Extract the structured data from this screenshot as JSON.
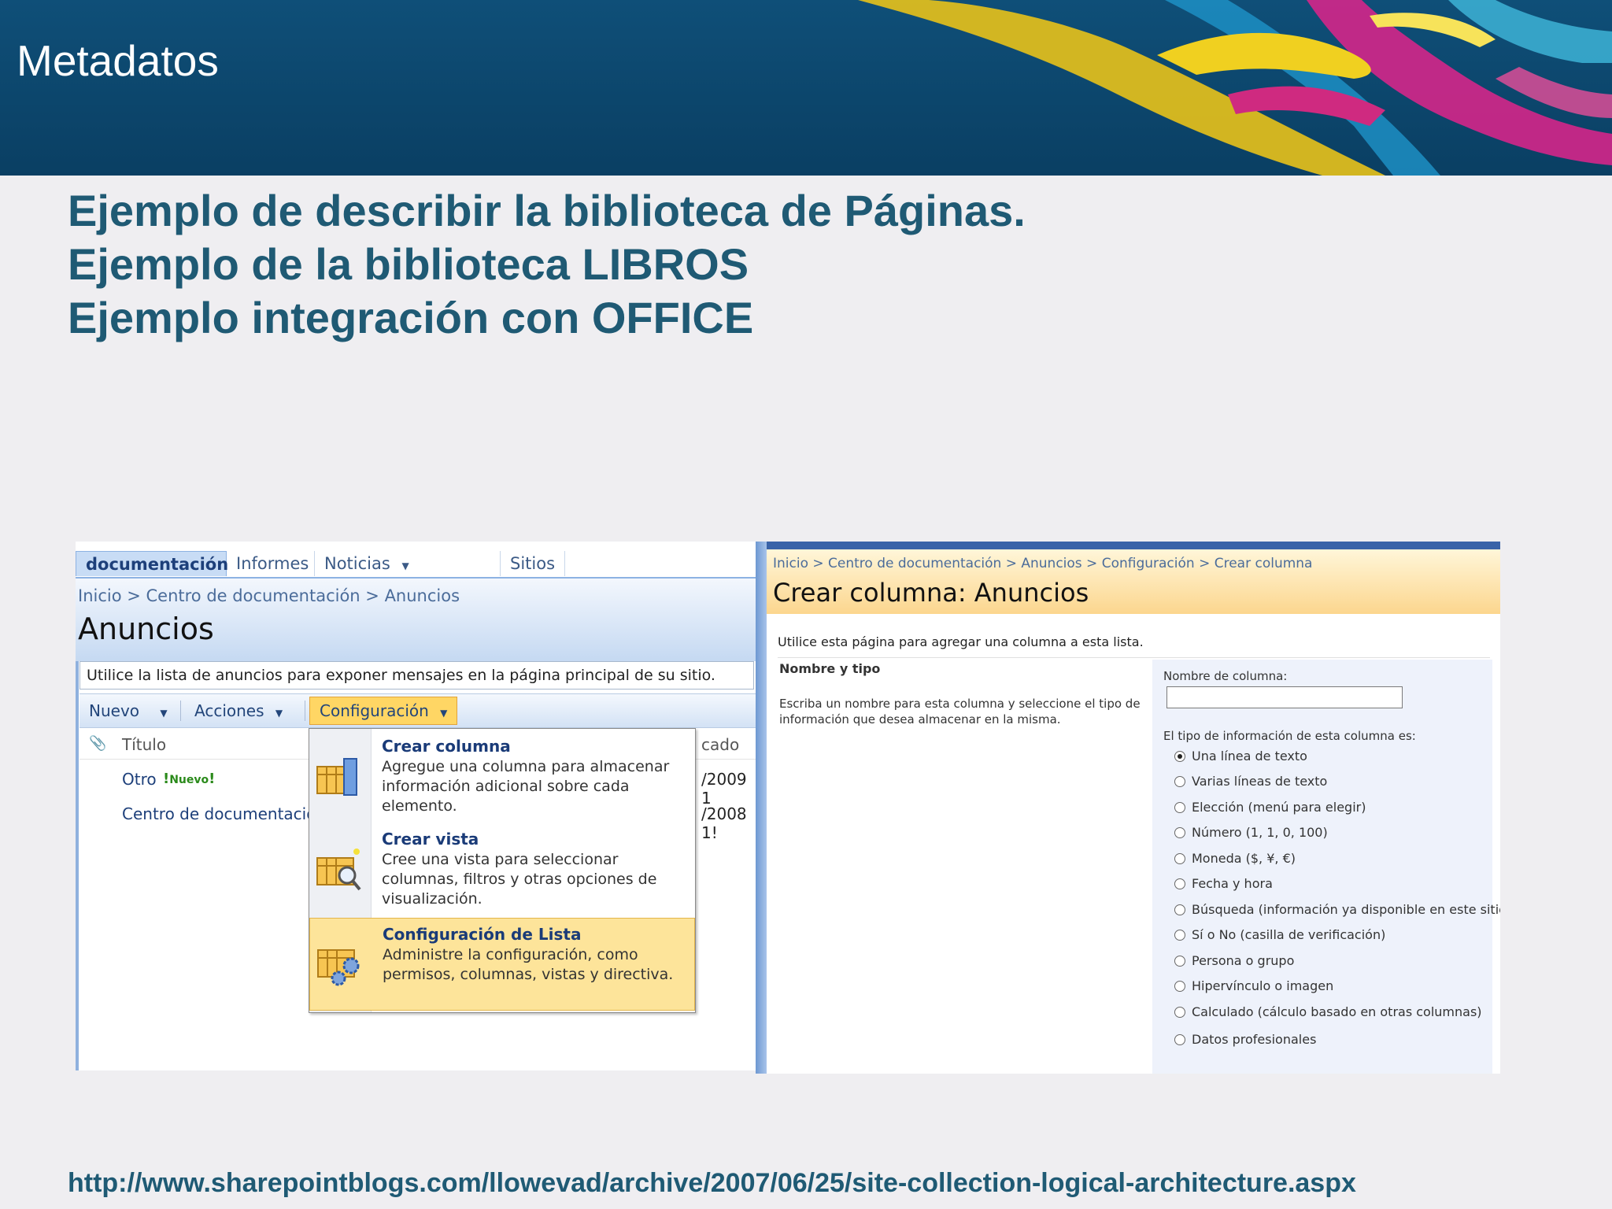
{
  "banner": {
    "title": "Metadatos"
  },
  "heading": {
    "lines": [
      "Ejemplo de describir la biblioteca de Páginas.",
      "Ejemplo de la biblioteca LIBROS",
      "Ejemplo integración con OFFICE"
    ]
  },
  "left_screenshot": {
    "tabs": [
      "documentación",
      "Informes",
      "Noticias",
      "Sitios"
    ],
    "breadcrumb": "Inicio > Centro de documentación > Anuncios",
    "page_title": "Anuncios",
    "description": "Utilice la lista de anuncios para exponer mensajes en la página principal de su sitio.",
    "toolbar": {
      "nuevo": "Nuevo",
      "acciones": "Acciones",
      "configuracion": "Configuración"
    },
    "list_header": {
      "title": "Título",
      "modified_fragment": "cado"
    },
    "rows": [
      {
        "title": "Otro",
        "badge": "Nuevo",
        "date": "/2009 1"
      },
      {
        "title": "Centro de documentación",
        "date": "/2008 1!"
      }
    ]
  },
  "menu": {
    "items": [
      {
        "title": "Crear columna",
        "desc": "Agregue una columna para almacenar información adicional sobre cada elemento.",
        "icon": "create-column-icon"
      },
      {
        "title": "Crear vista",
        "desc": "Cree una vista para seleccionar columnas, filtros y otras opciones de visualización.",
        "icon": "create-view-icon"
      },
      {
        "title": "Configuración de Lista",
        "desc": "Administre la configuración, como permisos, columnas, vistas y directiva.",
        "icon": "list-settings-icon"
      }
    ]
  },
  "right_screenshot": {
    "breadcrumb": "Inicio > Centro de documentación > Anuncios > Configuración > Crear columna",
    "title": "Crear columna: Anuncios",
    "intro": "Utilice esta página para agregar una columna a esta lista.",
    "section_title": "Nombre y tipo",
    "section_desc": "Escriba un nombre para esta columna y seleccione el tipo de información que desea almacenar en la misma.",
    "column_name_label": "Nombre de columna:",
    "column_name_value": "",
    "type_label": "El tipo de información de esta columna es:",
    "options": [
      "Una línea de texto",
      "Varias líneas de texto",
      "Elección (menú para elegir)",
      "Número (1, 1, 0, 100)",
      "Moneda ($, ¥, €)",
      "Fecha y hora",
      "Búsqueda (información ya disponible en este sitio)",
      "Sí o No (casilla de verificación)",
      "Persona o grupo",
      "Hipervínculo o imagen",
      "Calculado (cálculo basado en otras columnas)",
      "Datos profesionales"
    ],
    "selected_option": "Una línea de texto"
  },
  "footer": {
    "url": "http://www.sharepointblogs.com/llowevad/archive/2007/06/25/site-collection-logical-architecture.aspx"
  }
}
